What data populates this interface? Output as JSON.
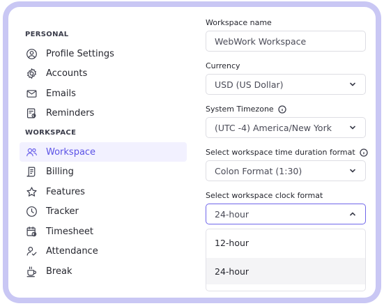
{
  "sidebar": {
    "personal_label": "PERSONAL",
    "personal_items": [
      {
        "label": "Profile Settings",
        "icon": "user-circle-icon"
      },
      {
        "label": "Accounts",
        "icon": "gear-icon"
      },
      {
        "label": "Emails",
        "icon": "envelope-icon"
      },
      {
        "label": "Reminders",
        "icon": "reminder-icon"
      }
    ],
    "workspace_label": "WORKSPACE",
    "workspace_items": [
      {
        "label": "Workspace",
        "icon": "users-icon",
        "active": true
      },
      {
        "label": "Billing",
        "icon": "receipt-icon"
      },
      {
        "label": "Features",
        "icon": "star-icon"
      },
      {
        "label": "Tracker",
        "icon": "clock-icon"
      },
      {
        "label": "Timesheet",
        "icon": "calendar-clock-icon"
      },
      {
        "label": "Attendance",
        "icon": "user-check-icon"
      },
      {
        "label": "Break",
        "icon": "coffee-cup-icon"
      }
    ]
  },
  "form": {
    "workspace_name_label": "Workspace name",
    "workspace_name_value": "WebWork Workspace",
    "currency_label": "Currency",
    "currency_value": "USD (US Dollar)",
    "timezone_label": "System Timezone",
    "timezone_value": "(UTC -4) America/New York",
    "duration_label": "Select workspace time duration format",
    "duration_value": "Colon Format (1:30)",
    "clock_label": "Select workspace clock format",
    "clock_value": "24-hour",
    "clock_options": [
      "12-hour",
      "24-hour"
    ]
  },
  "colors": {
    "accent": "#5b52e6",
    "active_bg": "#f2f1ff",
    "frame": "#c9c7f4"
  }
}
